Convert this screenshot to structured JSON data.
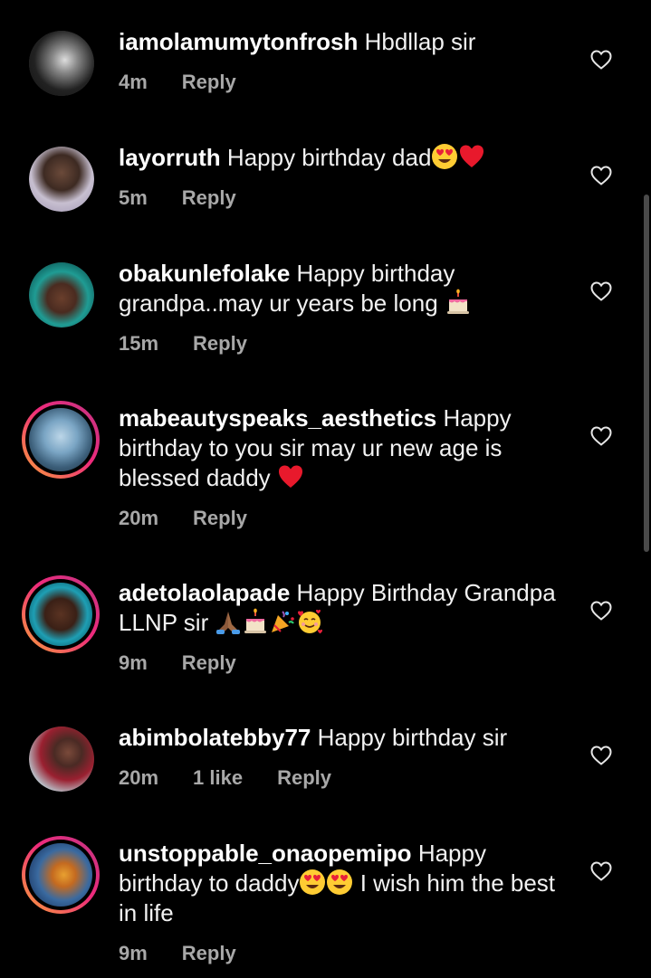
{
  "comments": [
    {
      "username": "iamolamumytonfrosh",
      "text": "Hbdllap sir",
      "time": "4m",
      "likes": "",
      "reply": "Reply"
    },
    {
      "username": "layorruth",
      "text": "Happy birthday dad",
      "time": "5m",
      "likes": "",
      "reply": "Reply"
    },
    {
      "username": "obakunlefolake",
      "text": "Happy birthday grandpa..may ur years be long",
      "time": "15m",
      "likes": "",
      "reply": "Reply"
    },
    {
      "username": "mabeautyspeaks_aesthetics",
      "text": "Happy birthday to you sir may ur new age is blessed daddy",
      "time": "20m",
      "likes": "",
      "reply": "Reply"
    },
    {
      "username": "adetolaolapade",
      "text": "Happy Birthday Grandpa LLNP sir",
      "time": "9m",
      "likes": "",
      "reply": "Reply"
    },
    {
      "username": "abimbolatebby77",
      "text": "Happy birthday sir",
      "time": "20m",
      "likes": "1 like",
      "reply": "Reply"
    },
    {
      "username": "unstoppable_onaopemipo",
      "text_before": "Happy birthday to daddy",
      "text_after": "I wish him the best in life",
      "time": "9m",
      "likes": "",
      "reply": "Reply"
    }
  ],
  "icons": {
    "heart": "heart-outline-icon",
    "heart_eyes": "heart-eyes-emoji",
    "red_heart": "red-heart-emoji",
    "cake": "birthday-cake-emoji",
    "pray": "folded-hands-emoji",
    "party": "party-popper-emoji",
    "hearts_face": "smiling-face-with-hearts-emoji"
  },
  "colors": {
    "background": "#000000",
    "meta_text": "#a8a8a8",
    "story_ring_start": "#f9a13a",
    "story_ring_end": "#c13584"
  }
}
